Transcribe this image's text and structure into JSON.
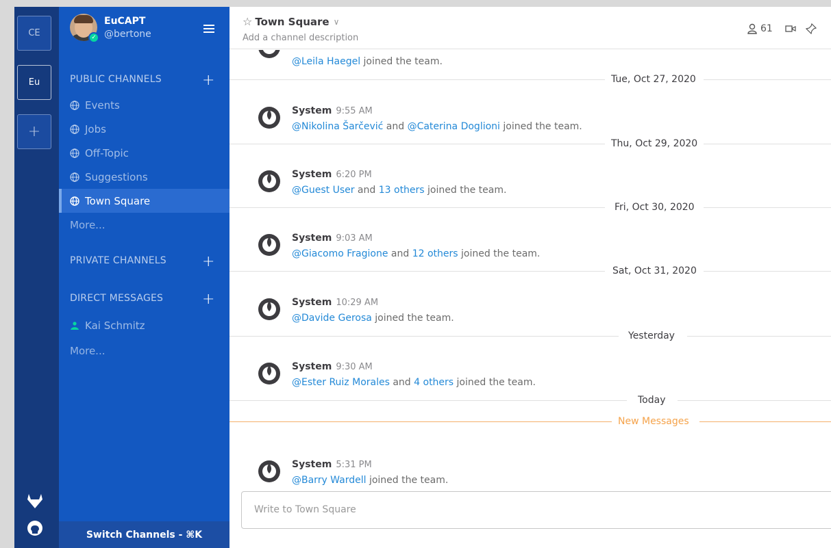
{
  "teams": {
    "items": [
      {
        "label": "CE"
      },
      {
        "label": "Eu"
      }
    ],
    "add_label": "+"
  },
  "header": {
    "team_name": "EuCAPT",
    "username": "@bertone"
  },
  "sidebar": {
    "public_title": "PUBLIC CHANNELS",
    "public_channels": [
      {
        "label": "Events"
      },
      {
        "label": "Jobs"
      },
      {
        "label": "Off-Topic"
      },
      {
        "label": "Suggestions"
      },
      {
        "label": "Town Square"
      }
    ],
    "public_more": "More...",
    "private_title": "PRIVATE CHANNELS",
    "dm_title": "DIRECT MESSAGES",
    "dm_items": [
      {
        "label": "Kai Schmitz"
      }
    ],
    "dm_more": "More...",
    "switch_label": "Switch Channels - ⌘K"
  },
  "channel": {
    "title": "Town Square",
    "description": "Add a channel description",
    "member_count": "61"
  },
  "posts": {
    "top_partial": {
      "mention": "@Leila Haegel",
      "text": " joined the team."
    },
    "dates": {
      "d1": "Tue, Oct 27, 2020",
      "d2": "Thu, Oct 29, 2020",
      "d3": "Fri, Oct 30, 2020",
      "d4": "Sat, Oct 31, 2020",
      "d5": "Yesterday",
      "d6": "Today",
      "new": "New Messages"
    },
    "items": [
      {
        "name": "System",
        "time": "9:55 AM",
        "m1": "@Nikolina Šarčević",
        "t1": " and ",
        "m2": "@Caterina Doglioni",
        "t2": " joined the team."
      },
      {
        "name": "System",
        "time": "6:20 PM",
        "m1": "@Guest User",
        "t1": " and ",
        "m2": "13 others",
        "t2": " joined the team."
      },
      {
        "name": "System",
        "time": "9:03 AM",
        "m1": "@Giacomo Fragione",
        "t1": " and ",
        "m2": "12 others",
        "t2": " joined the team."
      },
      {
        "name": "System",
        "time": "10:29 AM",
        "m1": "@Davide Gerosa",
        "t1": " joined the team."
      },
      {
        "name": "System",
        "time": "9:30 AM",
        "m1": "@Ester Ruiz Morales",
        "t1": " and ",
        "m2": "4 others",
        "t2": " joined the team."
      },
      {
        "name": "System",
        "time": "5:31 PM",
        "m1": "@Barry Wardell",
        "t1": " joined the team."
      }
    ]
  },
  "composer": {
    "placeholder": "Write to Town Square"
  },
  "colors": {
    "team_bar": "#153a7d",
    "sidebar": "#1358c1",
    "mention": "#2389d7",
    "new_messages": "#f5a34b",
    "online": "#06d6a0"
  }
}
